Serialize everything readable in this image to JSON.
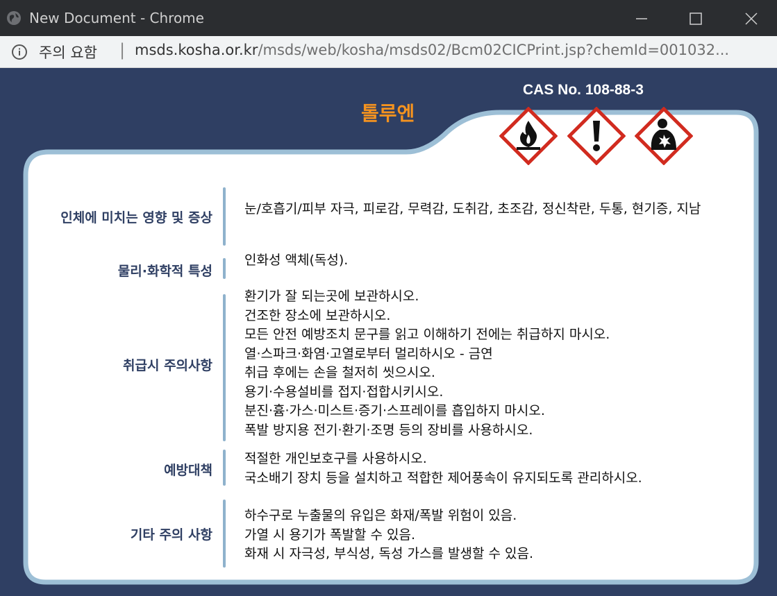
{
  "window": {
    "title": "New Document - Chrome",
    "controls": {
      "minimize": "minimize-icon",
      "maximize": "maximize-icon",
      "close": "close-icon"
    }
  },
  "address_bar": {
    "site_label": "주의 요함",
    "separator": "|",
    "url_domain": "msds.kosha.or.kr",
    "url_path": "/msds/web/kosha/msds02/Bcm02CICPrint.jsp?chemId=001032..."
  },
  "page": {
    "cas": "CAS No. 108-88-3",
    "chemical_name": "톨루엔",
    "pictograms": [
      "flame-icon",
      "exclamation-icon",
      "health-hazard-icon"
    ],
    "colors": {
      "background": "#2f3f63",
      "accent": "#f5931f",
      "pictogram_border": "#d12b1f",
      "label": "#2f3f63"
    },
    "sections": [
      {
        "label": "인체에 미치는 영향 및 증상",
        "lines": [
          "눈/호흡기/피부 자극, 피로감, 무력감, 도취감, 초조감, 정신착란, 두통, 현기증, 지남"
        ]
      },
      {
        "label": "물리·화학적 특성",
        "lines": [
          "인화성 액체(독성)."
        ]
      },
      {
        "label": "취급시 주의사항",
        "lines": [
          "환기가 잘 되는곳에 보관하시오.",
          "건조한 장소에 보관하시오.",
          "모든 안전 예방조치 문구를 읽고 이해하기 전에는 취급하지 마시오.",
          "열·스파크·화염·고열로부터 멀리하시오 - 금연",
          "취급 후에는 손을 철저히 씻으시오.",
          "용기·수용설비를 접지·접합시키시오.",
          "분진·흄·가스·미스트·증기·스프레이를 흡입하지 마시오.",
          "폭발 방지용 전기·환기·조명 등의 장비를 사용하시오."
        ]
      },
      {
        "label": "예방대책",
        "lines": [
          "적절한 개인보호구를 사용하시오.",
          "국소배기 장치 등을 설치하고 적합한 제어풍속이 유지되도록 관리하시오."
        ]
      },
      {
        "label": "기타 주의 사항",
        "lines": [
          "하수구로 누출물의 유입은 화재/폭발 위험이 있음.",
          "가열 시 용기가 폭발할 수 있음.",
          "화재 시 자극성, 부식성, 독성 가스를 발생할 수 있음."
        ]
      }
    ]
  }
}
